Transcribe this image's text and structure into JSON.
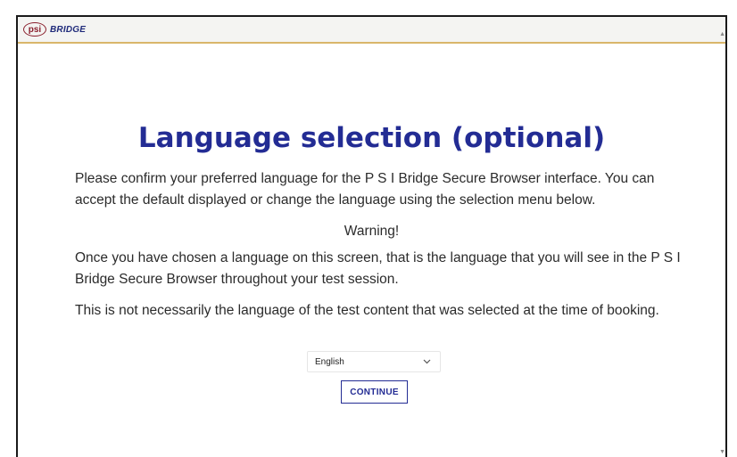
{
  "logo": {
    "psi_text": "psi",
    "bridge_text": "BRIDGE"
  },
  "title": "Language selection (optional)",
  "paragraphs": {
    "intro": "Please confirm your preferred language for the P S I Bridge Secure Browser interface. You can accept the default displayed or change the language using the selection menu below.",
    "warning": "Warning!",
    "notice": "Once you have chosen a language on this screen, that is the language that you will see in the P S I Bridge Secure Browser throughout your test session.",
    "disclaimer": "This is not necessarily the language of the test content that was selected at the time of booking."
  },
  "language_select": {
    "selected": "English",
    "icon": "chevron-down-icon"
  },
  "continue_label": "CONTINUE",
  "colors": {
    "title": "#232c94",
    "button": "#232c94",
    "logo_psi": "#8a1f2d",
    "topbar_border": "#d9b66a"
  }
}
